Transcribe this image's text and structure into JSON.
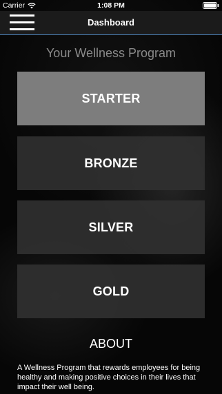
{
  "status_bar": {
    "carrier": "Carrier",
    "time": "1:08 PM"
  },
  "nav": {
    "title": "Dashboard",
    "menu_icon": "hamburger-menu-icon"
  },
  "program_title": "Your Wellness Program",
  "tiers": [
    {
      "label": "STARTER",
      "selected": true
    },
    {
      "label": "BRONZE",
      "selected": false
    },
    {
      "label": "SILVER",
      "selected": false
    },
    {
      "label": "GOLD",
      "selected": false
    }
  ],
  "about": {
    "title": "ABOUT",
    "text": "A Wellness Program that rewards employees for being healthy and making positive choices in their lives that impact their well being."
  },
  "colors": {
    "accent": "#4e86bf",
    "selected_tier": "#7d7d7d",
    "tier": "#303030"
  }
}
